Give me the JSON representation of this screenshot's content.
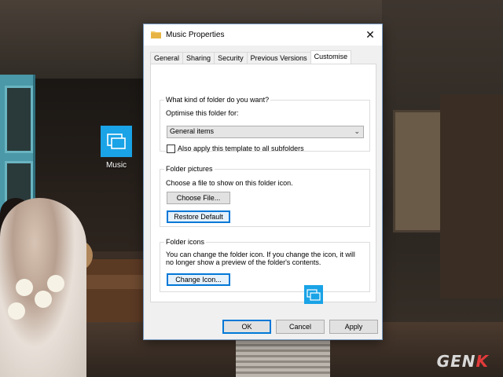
{
  "desktop": {
    "icon_label": "Music",
    "watermark": {
      "text": "GEN",
      "accent_letter": "K"
    }
  },
  "dialog": {
    "title": "Music Properties",
    "close_glyph": "✕",
    "tabs": [
      {
        "label": "General",
        "active": false
      },
      {
        "label": "Sharing",
        "active": false
      },
      {
        "label": "Security",
        "active": false
      },
      {
        "label": "Previous Versions",
        "active": false
      },
      {
        "label": "Customise",
        "active": true
      }
    ],
    "folder_type": {
      "legend": "What kind of folder do you want?",
      "optimise_label": "Optimise this folder for:",
      "selected": "General items",
      "apply_subfolders_label": "Also apply this template to all subfolders",
      "apply_subfolders_checked": false
    },
    "folder_pictures": {
      "legend": "Folder pictures",
      "description": "Choose a file to show on this folder icon.",
      "choose_file_label": "Choose File...",
      "restore_default_label": "Restore Default"
    },
    "folder_icons": {
      "legend": "Folder icons",
      "description_line1": "You can change the folder icon. If you change the icon, it will",
      "description_line2": "no longer show a preview of the folder's contents.",
      "change_icon_label": "Change Icon..."
    },
    "footer": {
      "ok_label": "OK",
      "cancel_label": "Cancel",
      "apply_label": "Apply"
    }
  },
  "colors": {
    "accent": "#0078d7",
    "icon_tile": "#1aa3e6",
    "watermark_accent": "#e23a3a"
  }
}
